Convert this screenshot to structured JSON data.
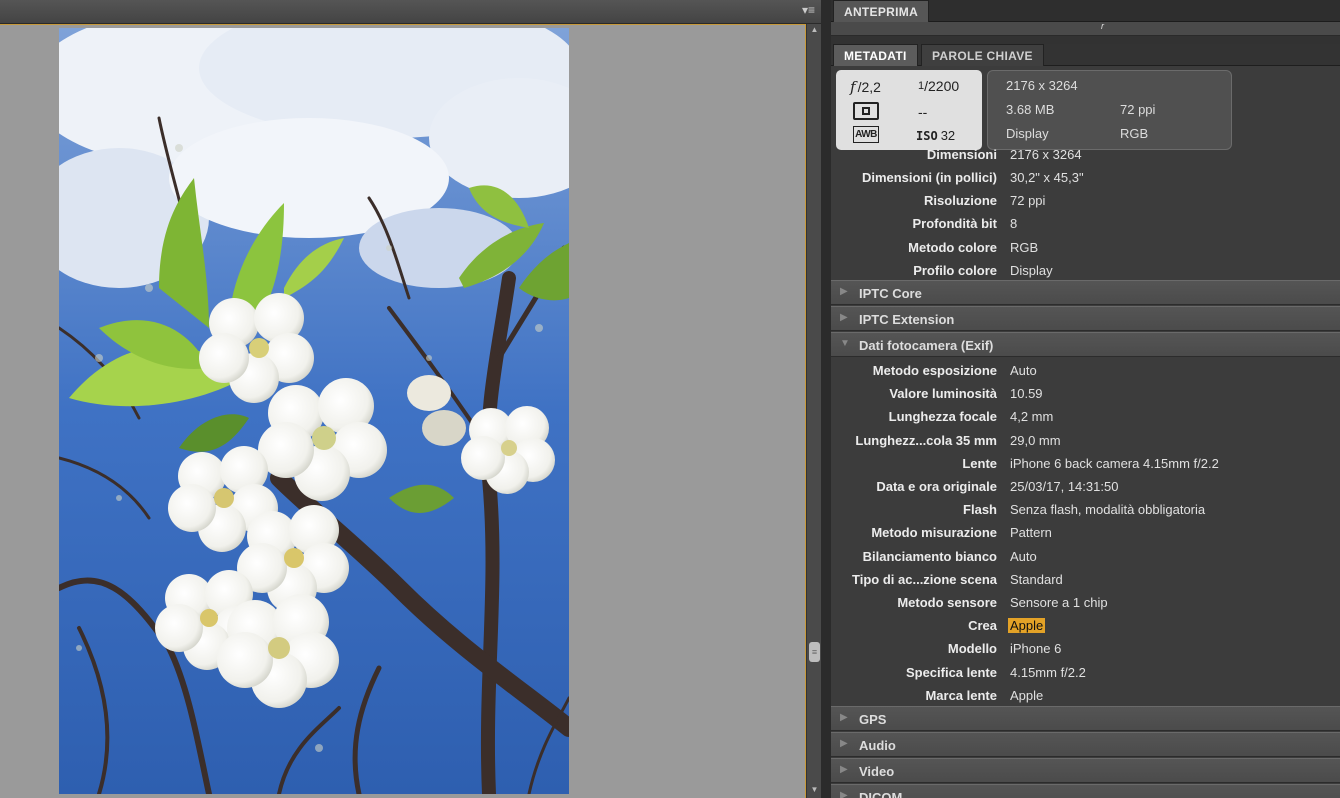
{
  "left_panel": {
    "menu_icon": "panel-menu-icon",
    "image_alt": "cherry-blossom-photo"
  },
  "preview_tab": "ANTEPRIMA",
  "preview_marker": "r",
  "tabs": {
    "metadata": "METADATI",
    "keywords": "PAROLE CHIAVE"
  },
  "camera_summary": {
    "aperture_prefix": "f",
    "aperture_value": "/2,2",
    "shutter_numerator": "1",
    "shutter_denominator": "/2200",
    "metering": "--",
    "white_balance": "AWB",
    "iso_label": "ISO",
    "iso_value": "32"
  },
  "file_summary": {
    "dimensions": "2176 x 3264",
    "size": "3.68 MB",
    "resolution": "72 ppi",
    "profile": "Display",
    "mode": "RGB"
  },
  "file_properties": [
    {
      "key": "Dimensioni",
      "value": "2176 x 3264"
    },
    {
      "key": "Dimensioni (in pollici)",
      "value": "30,2\" x 45,3\""
    },
    {
      "key": "Risoluzione",
      "value": "72 ppi"
    },
    {
      "key": "Profondità bit",
      "value": "8"
    },
    {
      "key": "Metodo colore",
      "value": "RGB"
    },
    {
      "key": "Profilo colore",
      "value": "Display"
    }
  ],
  "sections": {
    "iptc_core": "IPTC Core",
    "iptc_ext": "IPTC Extension",
    "exif": "Dati fotocamera (Exif)",
    "gps": "GPS",
    "audio": "Audio",
    "video": "Video",
    "dicom": "DICOM"
  },
  "exif": [
    {
      "key": "Metodo esposizione",
      "value": "Auto"
    },
    {
      "key": "Valore luminosità",
      "value": "10.59"
    },
    {
      "key": "Lunghezza focale",
      "value": "4,2 mm"
    },
    {
      "key": "Lunghezz...cola 35 mm",
      "value": "29,0 mm"
    },
    {
      "key": "Lente",
      "value": "iPhone 6 back camera 4.15mm f/2.2"
    },
    {
      "key": "Data e ora originale",
      "value": "25/03/17, 14:31:50"
    },
    {
      "key": "Flash",
      "value": "Senza flash, modalità obbligatoria"
    },
    {
      "key": "Metodo misurazione",
      "value": "Pattern"
    },
    {
      "key": "Bilanciamento bianco",
      "value": "Auto"
    },
    {
      "key": "Tipo di ac...zione scena",
      "value": "Standard"
    },
    {
      "key": "Metodo sensore",
      "value": "Sensore a 1 chip"
    },
    {
      "key": "Crea",
      "value": "Apple"
    },
    {
      "key": "Modello",
      "value": "iPhone 6"
    },
    {
      "key": "Specifica lente",
      "value": "4.15mm f/2.2"
    },
    {
      "key": "Marca lente",
      "value": "Apple"
    }
  ],
  "colors": {
    "accent_highlight": "#e3a227",
    "panel_border": "#c89a3a"
  }
}
